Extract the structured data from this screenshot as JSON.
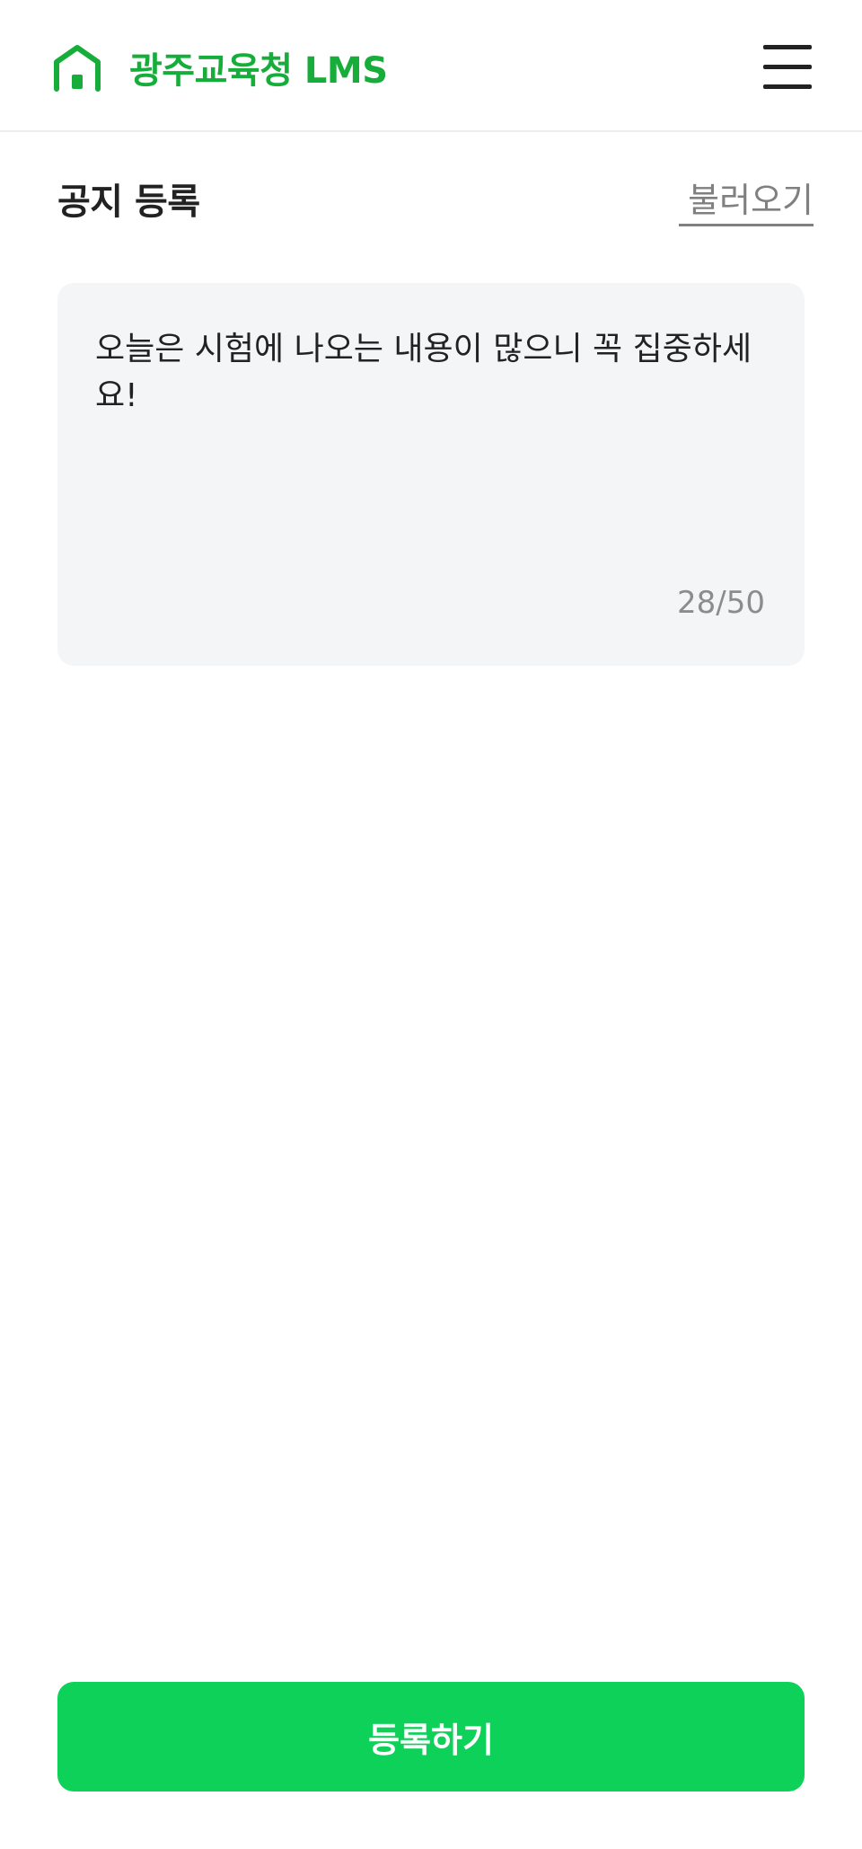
{
  "header": {
    "logo_icon": "home-icon",
    "app_title": "광주교육청 LMS",
    "menu_icon": "hamburger-menu-icon",
    "brand_color": "#17ad3a"
  },
  "page": {
    "title": "공지 등록",
    "load_link": "불러오기"
  },
  "notice": {
    "text": "오늘은 시험에 나오는 내용이 많으니 꼭 집중하세요!",
    "char_count": "28/50",
    "current_length": 28,
    "max_length": 50
  },
  "footer": {
    "submit_label": "등록하기",
    "button_color": "#0dd158"
  }
}
